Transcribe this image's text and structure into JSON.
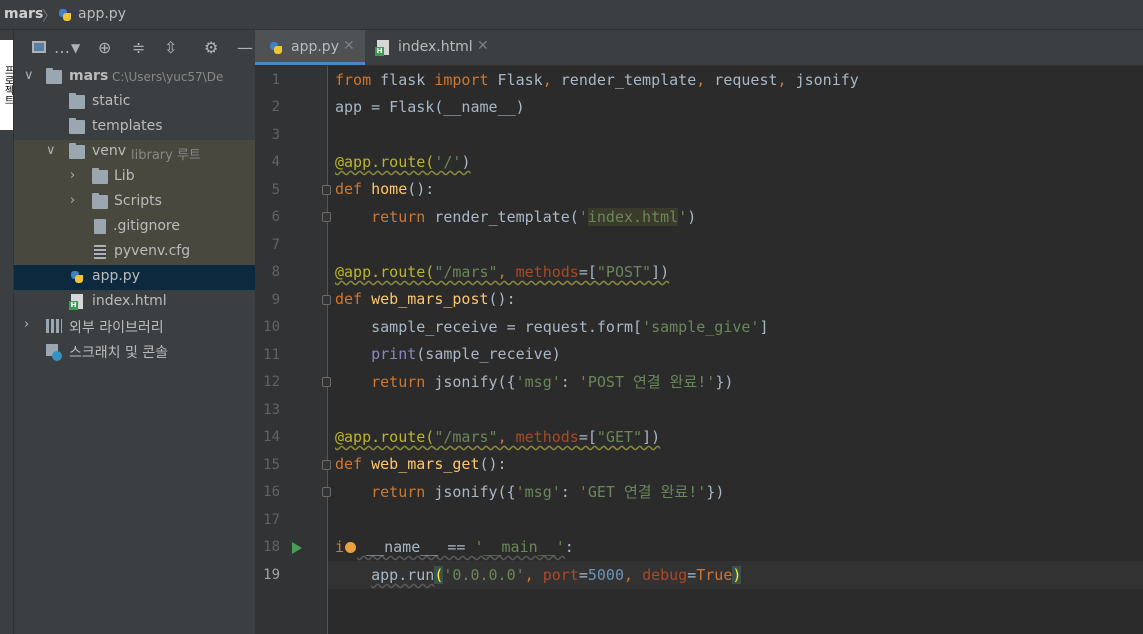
{
  "breadcrumb": {
    "project": "mars",
    "file": "app.py"
  },
  "left_strip": {
    "tab_label": "프로젝트"
  },
  "tree": {
    "root": {
      "name": "mars",
      "path": "C:\\Users\\yuc57\\De"
    },
    "static": "static",
    "templates": "templates",
    "venv": {
      "name": "venv",
      "hint": "library 루트"
    },
    "lib": "Lib",
    "scripts": "Scripts",
    "gitignore": ".gitignore",
    "pyvenv": "pyvenv.cfg",
    "app_py": "app.py",
    "index_html": "index.html",
    "external_libs": "외부 라이브러리",
    "scratches": "스크래치 및 콘솔"
  },
  "tabs": [
    {
      "label": "app.py",
      "active": true
    },
    {
      "label": "index.html",
      "active": false
    }
  ],
  "line_numbers": [
    "1",
    "2",
    "3",
    "4",
    "5",
    "6",
    "7",
    "8",
    "9",
    "10",
    "11",
    "12",
    "13",
    "14",
    "15",
    "16",
    "17",
    "18",
    "19"
  ],
  "code": {
    "l1": {
      "from": "from",
      "flask": " flask ",
      "import": "import",
      "rest": " Flask",
      "c1": ",",
      "rt": " render_template",
      "c2": ",",
      "req": " request",
      "c3": ",",
      "js": " jsonify"
    },
    "l2": {
      "text": "app = Flask(__name__)"
    },
    "l4": {
      "dec": "@app.route(",
      "arg": "'/'",
      "close": ")"
    },
    "l5": {
      "def": "def",
      "name": " home",
      "rest": "():"
    },
    "l6": {
      "indent": "    ",
      "ret": "return",
      "call": " render_template(",
      "q1": "'",
      "file": "index.html",
      "q2": "'",
      "close": ")"
    },
    "l8": {
      "dec": "@app.route(",
      "arg": "\"/mars\"",
      "comma": ", ",
      "param": "methods",
      "eq": "=[",
      "val": "\"POST\"",
      "close": "])"
    },
    "l9": {
      "def": "def",
      "name": " web_mars_post",
      "rest": "():"
    },
    "l10": {
      "indent": "    ",
      "pre": "sample_receive = request.form[",
      "key": "'sample_give'",
      "close": "]"
    },
    "l11": {
      "indent": "    ",
      "print": "print",
      "rest": "(sample_receive)"
    },
    "l12": {
      "indent": "    ",
      "ret": "return",
      "pre": " jsonify({",
      "k": "'msg'",
      "mid": ": ",
      "v": "'POST 연결 완료!'",
      "close": "})"
    },
    "l14": {
      "dec": "@app.route(",
      "arg": "\"/mars\"",
      "comma": ", ",
      "param": "methods",
      "eq": "=[",
      "val": "\"GET\"",
      "close": "])"
    },
    "l15": {
      "def": "def",
      "name": " web_mars_get",
      "rest": "():"
    },
    "l16": {
      "indent": "    ",
      "ret": "return",
      "pre": " jsonify({",
      "k": "'msg'",
      "mid": ": ",
      "v": "'GET 연결 완료!'",
      "close": "})"
    },
    "l18": {
      "i": "i",
      "rest": " __name__ == ",
      "str": "'__main__'",
      "colon": ":"
    },
    "l19": {
      "indent": "    ",
      "pre": "app.run",
      "paren": "(",
      "a1": "'0.0.0.0'",
      "c1": ", ",
      "p1": "port",
      "eq1": "=",
      "n1": "5000",
      "c2": ", ",
      "p2": "debug",
      "eq2": "=",
      "v2": "True",
      "close": ")"
    }
  },
  "colors": {
    "bg": "#2b2b2b",
    "panel": "#3c3f41",
    "keyword": "#cc7832",
    "string": "#6a8759",
    "function": "#ffc66d",
    "decorator": "#bbb529",
    "number": "#6897bb",
    "selection": "#0d293e"
  }
}
